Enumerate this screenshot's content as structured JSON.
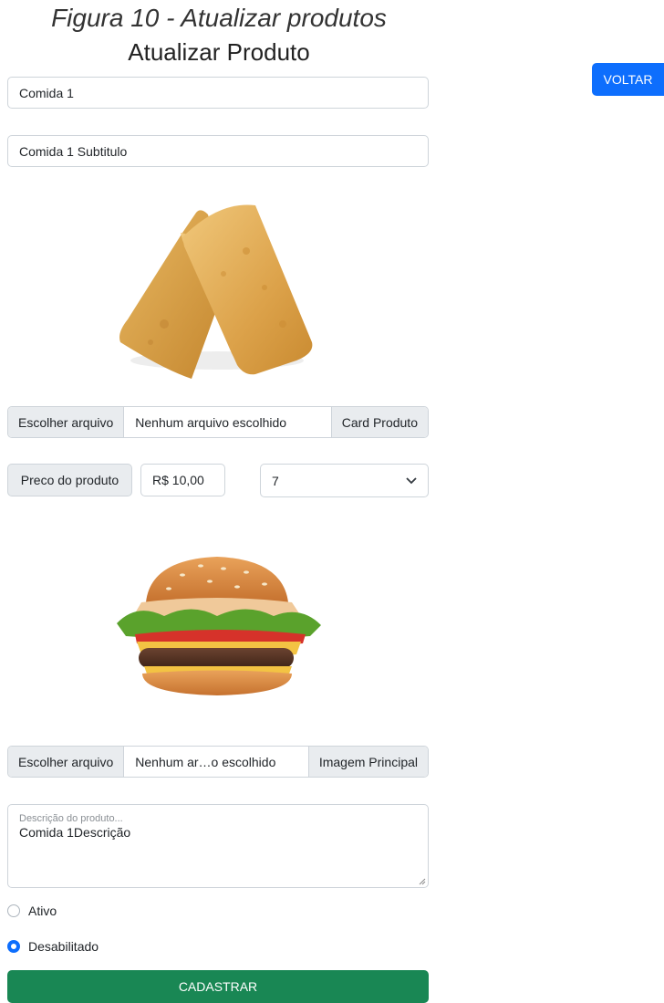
{
  "figure_caption": "Figura 10 - Atualizar produtos",
  "page_title": "Atualizar Produto",
  "back_button": "VOLTAR",
  "form": {
    "name_value": "Comida 1",
    "subtitle_value": "Comida 1 Subtitulo",
    "card_file": {
      "button": "Escolher arquivo",
      "status": "Nenhum arquivo escolhido",
      "label": "Card Produto"
    },
    "price": {
      "label": "Preco do produto",
      "value": "R$ 10,00"
    },
    "quantity_select": {
      "selected": "7"
    },
    "main_file": {
      "button": "Escolher arquivo",
      "status": "Nenhum ar…o escolhido",
      "label": "Imagem Principal"
    },
    "description": {
      "placeholder": "Descrição do produto...",
      "value": "Comida 1Descrição"
    },
    "status_options": [
      {
        "label": "Ativo",
        "checked": false
      },
      {
        "label": "Desabilitado",
        "checked": true
      }
    ],
    "submit_label": "CADASTRAR"
  },
  "images": {
    "card_image": "pastel-photo",
    "main_image": "burger-photo"
  },
  "colors": {
    "primary": "#0d6efd",
    "success": "#198754",
    "addon_bg": "#e9ecef",
    "border": "#ced4da"
  }
}
